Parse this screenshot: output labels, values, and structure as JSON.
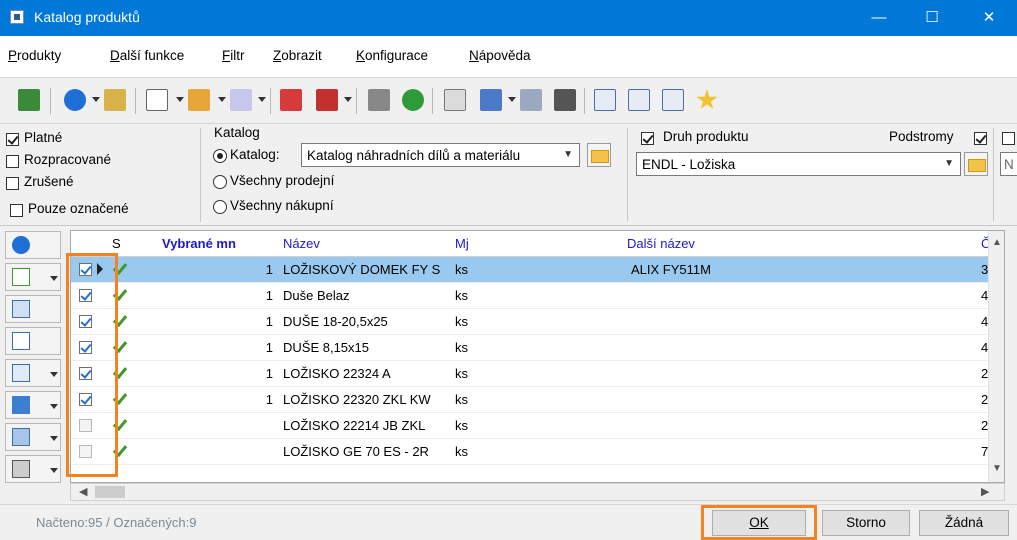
{
  "window": {
    "title": "Katalog produktů",
    "minimize": "—",
    "maximize": "☐",
    "close": "✕"
  },
  "menu": [
    {
      "accel": "P",
      "rest": "rodukty"
    },
    {
      "accel": "D",
      "rest": "alší funkce"
    },
    {
      "accel": "F",
      "rest": "iltr"
    },
    {
      "accel": "Z",
      "rest": "obrazit"
    },
    {
      "accel": "K",
      "rest": "onfigurace"
    },
    {
      "accel": "N",
      "rest": "ápověda"
    }
  ],
  "filters": {
    "status": [
      {
        "label": "Platné",
        "checked": true
      },
      {
        "label": "Rozpracované",
        "checked": false
      },
      {
        "label": "Zrušené",
        "checked": false
      },
      {
        "label": "Pouze označené",
        "checked": false
      }
    ],
    "catalog_group": "Katalog",
    "catalog_radio": "Katalog:",
    "catalog_value": "Katalog náhradních dílů a materiálu",
    "all_sales": "Všechny prodejní",
    "all_purchase": "Všechny nákupní",
    "product_type_label": "Druh produktu",
    "subtrees_label": "Podstromy",
    "product_type_value": "ENDL - Ložiska",
    "right_clip": "N"
  },
  "grid": {
    "columns": {
      "s": "S",
      "qty": "Vybrané mn",
      "name": "Název",
      "unit": "Mj",
      "other": "Další název",
      "last": "Č"
    },
    "rows": [
      {
        "checked": true,
        "qty": "1",
        "name": "LOŽISKOVÝ DOMEK FY S",
        "unit": "ks",
        "other": "ALIX FY511M",
        "last": "3",
        "selected": true
      },
      {
        "checked": true,
        "qty": "1",
        "name": "Duše Belaz",
        "unit": "ks",
        "other": "",
        "last": "4"
      },
      {
        "checked": true,
        "qty": "1",
        "name": "DUŠE 18-20,5x25",
        "unit": "ks",
        "other": "",
        "last": "4"
      },
      {
        "checked": true,
        "qty": "1",
        "name": "DUŠE 8,15x15",
        "unit": "ks",
        "other": "",
        "last": "4"
      },
      {
        "checked": true,
        "qty": "1",
        "name": "LOŽISKO 22324 A",
        "unit": "ks",
        "other": "",
        "last": "2"
      },
      {
        "checked": true,
        "qty": "1",
        "name": "LOŽISKO 22320 ZKL KW",
        "unit": "ks",
        "other": "",
        "last": "2"
      },
      {
        "checked": false,
        "qty": "",
        "name": "LOŽISKO 22214 JB ZKL",
        "unit": "ks",
        "other": "",
        "last": "2"
      },
      {
        "checked": false,
        "qty": "",
        "name": "LOŽISKO GE 70 ES - 2R",
        "unit": "ks",
        "other": "",
        "last": "7"
      }
    ]
  },
  "status": {
    "text": "Načteno:95 / Označených:9"
  },
  "buttons": {
    "ok": "OK",
    "cancel": "Storno",
    "none": "Žádná"
  },
  "colors": {
    "titlebar": "#0078d7",
    "selected_row": "#99c9ef",
    "highlight": "#f58220",
    "qty_header": "#1a1acc"
  }
}
